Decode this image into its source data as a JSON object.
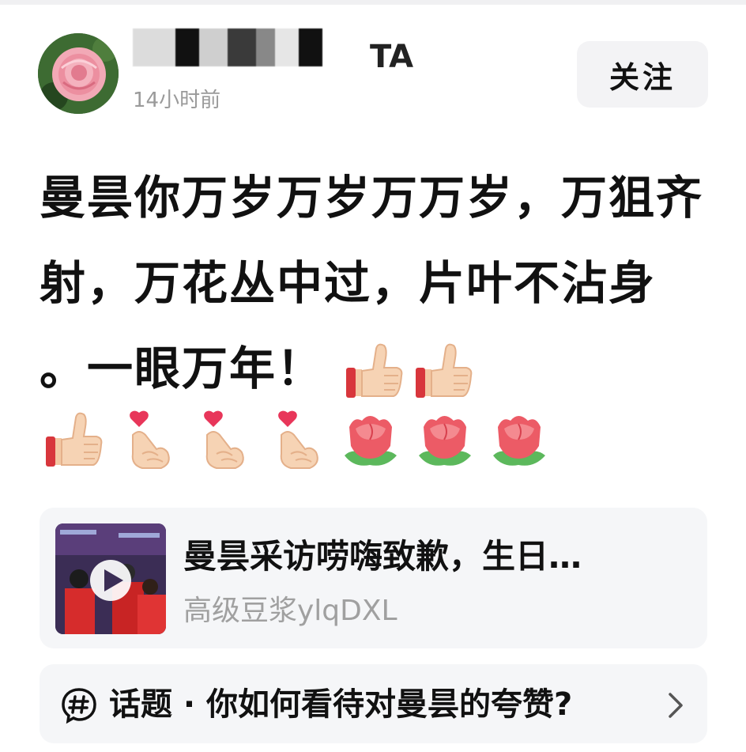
{
  "header": {
    "username": "······TA",
    "timestamp": "14小时前",
    "follow_label": "关注"
  },
  "post": {
    "text": "曼昙你万岁万岁万万岁，万狙齐射，万花丛中过，片叶不沾身 。一眼万年！",
    "emojis_inline": [
      "thumbs-up-icon",
      "thumbs-up-icon"
    ],
    "emojis_row": [
      "thumbs-up-icon",
      "finger-heart-icon",
      "finger-heart-icon",
      "finger-heart-icon",
      "rose-icon",
      "rose-icon",
      "rose-icon"
    ]
  },
  "video_card": {
    "title": "曼昙采访唠嗨致歉，生日…",
    "author": "高级豆浆ylqDXL"
  },
  "topic": {
    "text": "话题 · 你如何看待对曼昙的夸赞?"
  },
  "colors": {
    "card_bg": "#f5f6f8",
    "muted_text": "#9a9a9a",
    "main_text": "#111111"
  }
}
